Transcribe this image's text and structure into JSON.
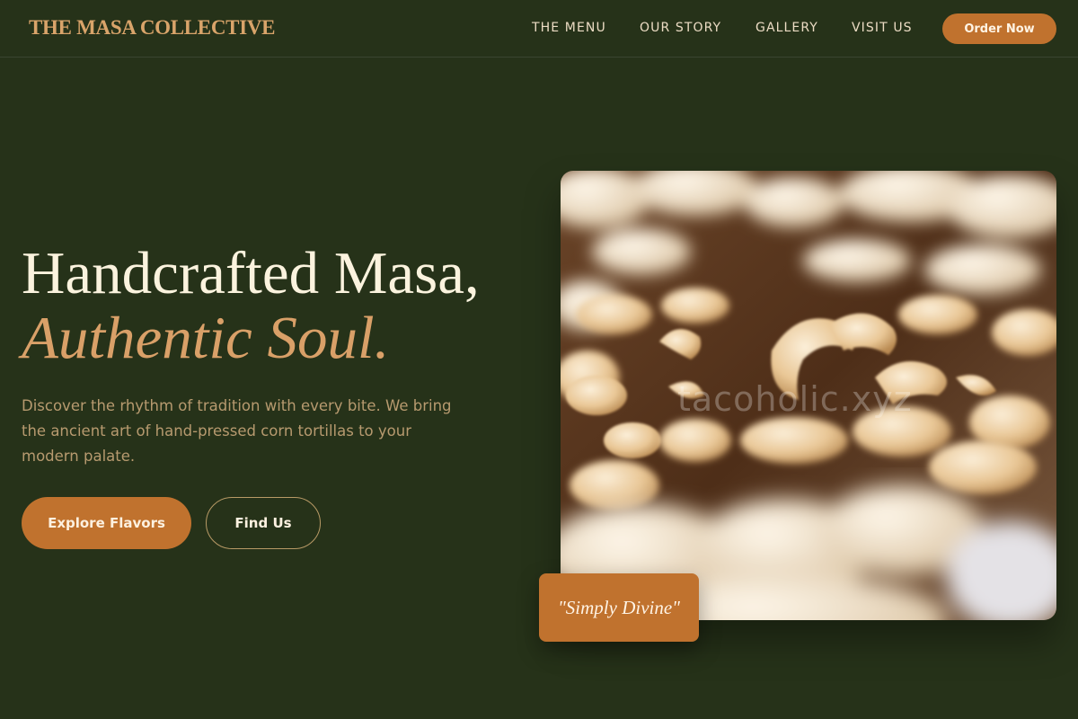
{
  "header": {
    "logo": "THE MASA COLLECTIVE",
    "nav": [
      {
        "label": "THE MENU"
      },
      {
        "label": "OUR STORY"
      },
      {
        "label": "GALLERY"
      },
      {
        "label": "VISIT US"
      }
    ],
    "order_label": "Order Now"
  },
  "hero": {
    "title_line1": "Handcrafted Masa,",
    "title_line2": "Authentic Soul.",
    "description": "Discover the rhythm of tradition with every bite. We bring the ancient art of hand-pressed corn tortillas to your modern palate.",
    "primary_label": "Explore Flavors",
    "secondary_label": "Find Us"
  },
  "image": {
    "watermark": "tacoholic.xyz",
    "quote": "\"Simply Divine\""
  },
  "colors": {
    "background": "#263219",
    "accent": "#c0722e",
    "logo": "#d9a46a",
    "title": "#fbf3de",
    "title_accent": "#d9a068"
  }
}
